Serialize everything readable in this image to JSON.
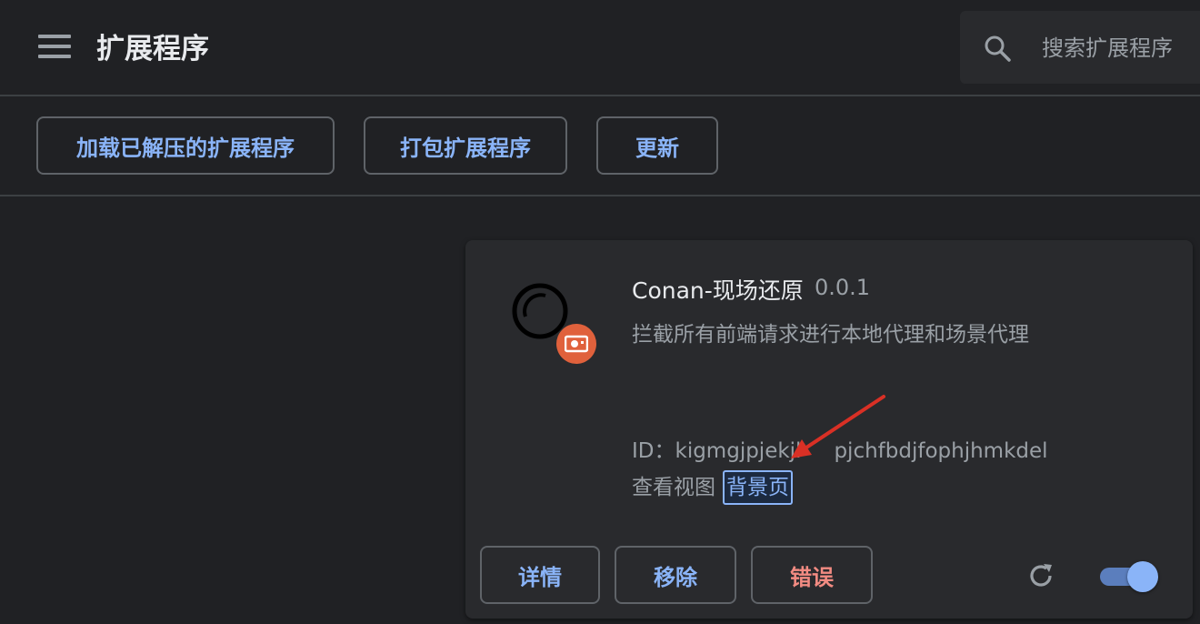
{
  "header": {
    "title": "扩展程序",
    "search": {
      "placeholder": "搜索扩展程序"
    },
    "menu_icon": "hamburger-menu-icon",
    "search_icon": "search-icon"
  },
  "toolbar": {
    "load_unpacked": "加载已解压的扩展程序",
    "pack": "打包扩展程序",
    "update": "更新"
  },
  "extension": {
    "name": "Conan-现场还原",
    "version": "0.0.1",
    "description": "拦截所有前端请求进行本地代理和场景代理",
    "id_label": "ID：",
    "id": "kigmgjpjekjl",
    "id_tail": "pjchfbdjfophjhmkdel",
    "views_label": "查看视图",
    "view_link": "背景页",
    "buttons": {
      "details": "详情",
      "remove": "移除",
      "errors": "错误"
    },
    "enabled": true,
    "badge_color": "#e0613c",
    "error_color": "#f28b82",
    "accent_color": "#8ab4f8"
  },
  "annotation": {
    "arrow_color": "#d93025"
  }
}
